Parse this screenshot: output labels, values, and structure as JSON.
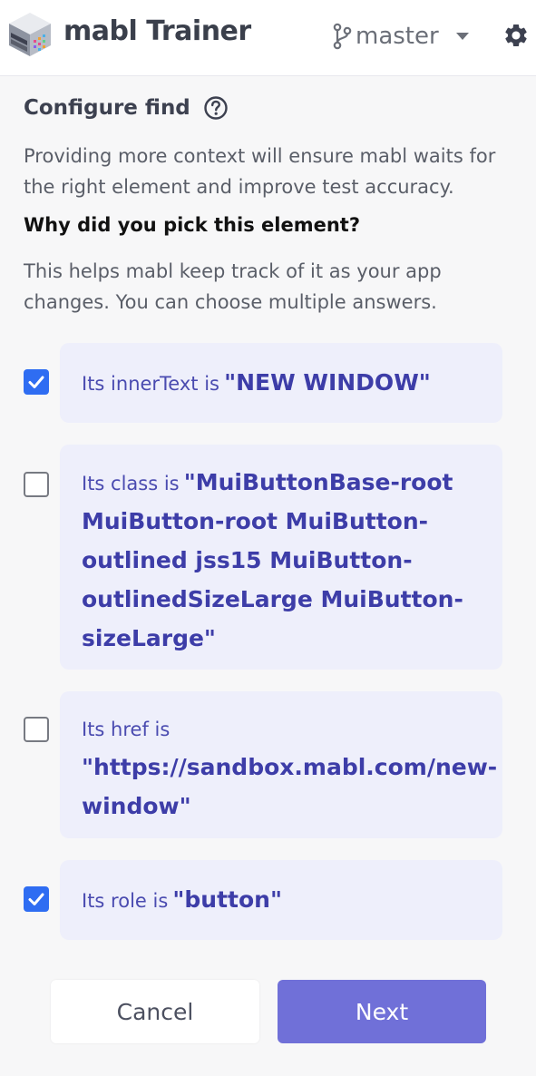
{
  "header": {
    "app_title": "mabl Trainer",
    "branch": "master"
  },
  "configure": {
    "title": "Configure find",
    "intro": "Providing more context will ensure mabl waits for the right element and improve test accuracy.",
    "question": "Why did you pick this element?",
    "hint": "This helps mabl keep track of it as your app changes. You can choose multiple answers."
  },
  "options": [
    {
      "prefix": "Its innerText is",
      "value": "\"NEW WINDOW\"",
      "checked": true
    },
    {
      "prefix": "Its class is",
      "value": "\"MuiButtonBase-root MuiButton-root MuiButton-outlined jss15 MuiButton-outlinedSizeLarge MuiButton-sizeLarge\"",
      "checked": false
    },
    {
      "prefix": "Its href is",
      "value": "\"https://sandbox.mabl.com/new-window\"",
      "checked": false
    },
    {
      "prefix": "Its role is",
      "value": "\"button\"",
      "checked": true
    }
  ],
  "buttons": {
    "cancel": "Cancel",
    "next": "Next"
  },
  "colors": {
    "accent": "#7070d8",
    "checkbox_checked": "#2f6df2",
    "option_bg": "#eeeffb",
    "option_text": "#3d3da8"
  }
}
